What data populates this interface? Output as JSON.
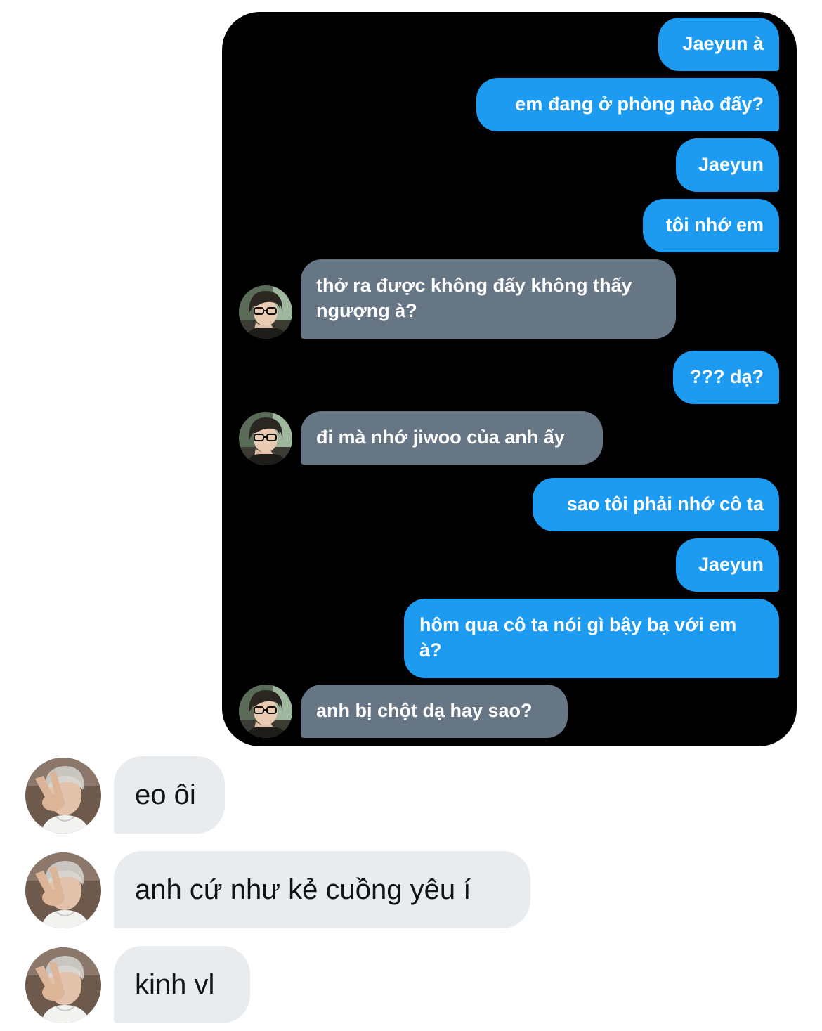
{
  "shared_image": {
    "messages": [
      {
        "dir": "sent",
        "text": "Jaeyun à"
      },
      {
        "dir": "sent",
        "text": "em đang ở phòng nào đấy?"
      },
      {
        "dir": "sent",
        "text": "Jaeyun"
      },
      {
        "dir": "sent",
        "text": "tôi nhớ em"
      },
      {
        "dir": "received",
        "text": "thở ra được không đấy không thấy ngượng à?"
      },
      {
        "dir": "sent",
        "text": "??? dạ?"
      },
      {
        "dir": "received",
        "text": "đi mà nhớ jiwoo của anh ấy"
      },
      {
        "dir": "sent",
        "text": "sao tôi phải nhớ cô ta"
      },
      {
        "dir": "sent",
        "text": "Jaeyun"
      },
      {
        "dir": "sent",
        "text": "hôm qua cô ta nói gì bậy bạ với em à?"
      },
      {
        "dir": "received",
        "text": "anh bị chột dạ hay sao?"
      }
    ]
  },
  "conversation": {
    "messages": [
      {
        "dir": "received",
        "text": "eo ôi"
      },
      {
        "dir": "received",
        "text": "anh cứ như kẻ cuồng yêu í"
      },
      {
        "dir": "received",
        "text": "kinh vl"
      }
    ]
  },
  "icons": {
    "inner_avatar": "avatar-photo-glasses",
    "outer_avatar": "avatar-photo-peace-sign"
  },
  "colors": {
    "sent_bubble": "#1d9bf0",
    "received_bubble_dark": "#667685",
    "received_bubble_light": "#e8ecef",
    "image_background": "#000000",
    "text_dark": "#0f1419"
  }
}
